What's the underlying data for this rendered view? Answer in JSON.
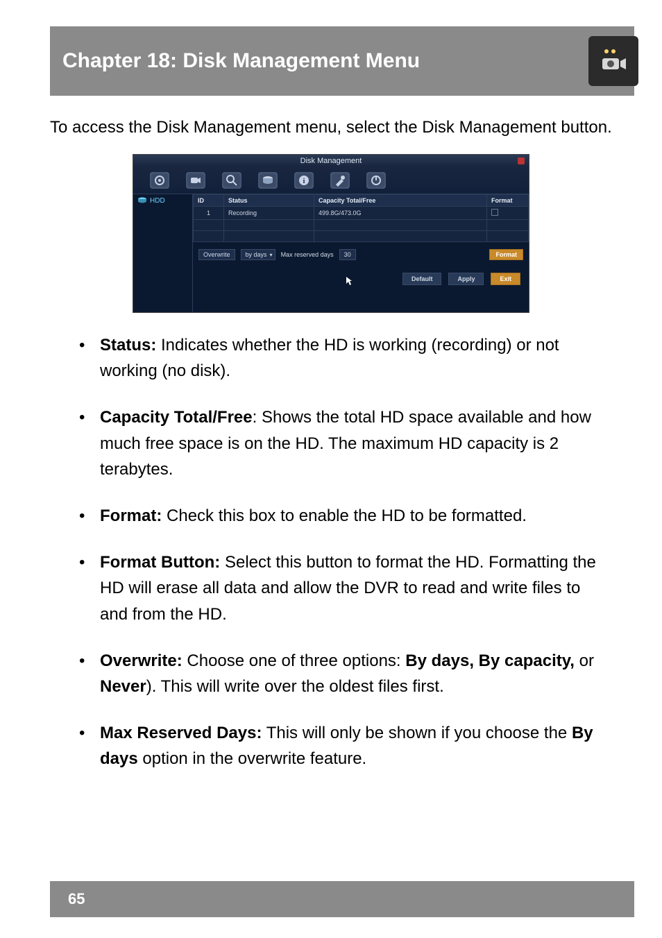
{
  "header": {
    "title": "Chapter 18: Disk Management Menu",
    "icon_name": "dvr-camera-icon"
  },
  "intro": "To access the Disk Management menu, select the Disk Management button.",
  "screenshot": {
    "window_title": "Disk Management",
    "toolbar_icons": [
      "settings-general-icon",
      "camera-icon",
      "magnifier-icon",
      "hdd-icon",
      "info-icon",
      "tools-icon",
      "power-icon"
    ],
    "sidebar": {
      "label": "HDD",
      "icon": "hdd-side-icon"
    },
    "table": {
      "headers": [
        "ID",
        "Status",
        "Capacity Total/Free",
        "Format"
      ],
      "rows": [
        {
          "id": "1",
          "status": "Recording",
          "capacity": "499.8G/473.0G",
          "format_checked": false
        }
      ]
    },
    "overwrite": {
      "label": "Overwrite",
      "mode": "by days",
      "max_label": "Max reserved days",
      "max_value": "30",
      "format_button": "Format"
    },
    "footer": {
      "default": "Default",
      "apply": "Apply",
      "exit": "Exit"
    }
  },
  "bullets": [
    {
      "bold": "Status:",
      "rest": " Indicates whether the HD is working (recording) or not working (no disk)."
    },
    {
      "bold": "Capacity Total/Free",
      "rest": ": Shows the total HD space available and how much free space is on the HD. The maximum HD capacity is 2 terabytes."
    },
    {
      "bold": "Format:",
      "rest": " Check this box to enable the HD to be formatted."
    },
    {
      "bold": "Format Button:",
      "rest": " Select this button to format the HD. Formatting the HD will erase all data and allow the DVR to read and write files to and from the HD."
    },
    {
      "bold": "Overwrite:",
      "rest_pre": " Choose one of three options: ",
      "bold2": "By days, By capacity,",
      "rest_mid": " or ",
      "bold3": "Never",
      "rest_post": "). This will write over the oldest files first."
    },
    {
      "bold": "Max Reserved Days:",
      "rest_pre": " This will only be shown if you choose the ",
      "bold2": "By days",
      "rest_post": " option in the overwrite feature."
    }
  ],
  "footer": {
    "page_number": "65"
  }
}
